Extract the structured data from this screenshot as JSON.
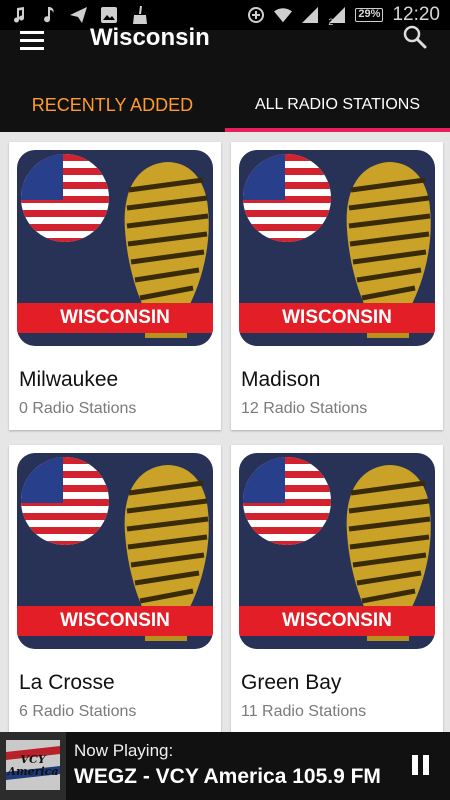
{
  "statusbar": {
    "left_icons": [
      "music-note-icon",
      "music-note-icon",
      "send-icon",
      "image-icon",
      "broom-icon"
    ],
    "right_icons": [
      "data-saver-icon",
      "wifi-icon",
      "signal-icon",
      "signal-icon"
    ],
    "signal_label": "2",
    "battery": "29%",
    "time": "12:20"
  },
  "appbar": {
    "title": "Wisconsin",
    "tabs": [
      {
        "label": "RECENTLY ADDED",
        "active": false
      },
      {
        "label": "ALL RADIO STATIONS",
        "active": true
      }
    ]
  },
  "cards": [
    {
      "thumb_label": "WISCONSIN",
      "city": "Milwaukee",
      "stations": "0 Radio Stations"
    },
    {
      "thumb_label": "WISCONSIN",
      "city": "Madison",
      "stations": "12 Radio Stations"
    },
    {
      "thumb_label": "WISCONSIN",
      "city": "La Crosse",
      "stations": "6 Radio Stations"
    },
    {
      "thumb_label": "WISCONSIN",
      "city": "Green Bay",
      "stations": "11 Radio Stations"
    }
  ],
  "player": {
    "now_playing_label": "Now Playing:",
    "station": "WEGZ - VCY America 105.9 FM",
    "art_text": "VCY America"
  },
  "colors": {
    "accent_tab": "#ff9b2e",
    "indicator": "#ec1d5e",
    "appbar": "#111111",
    "thumb_bg": "#283257",
    "banner": "#e41e26"
  }
}
